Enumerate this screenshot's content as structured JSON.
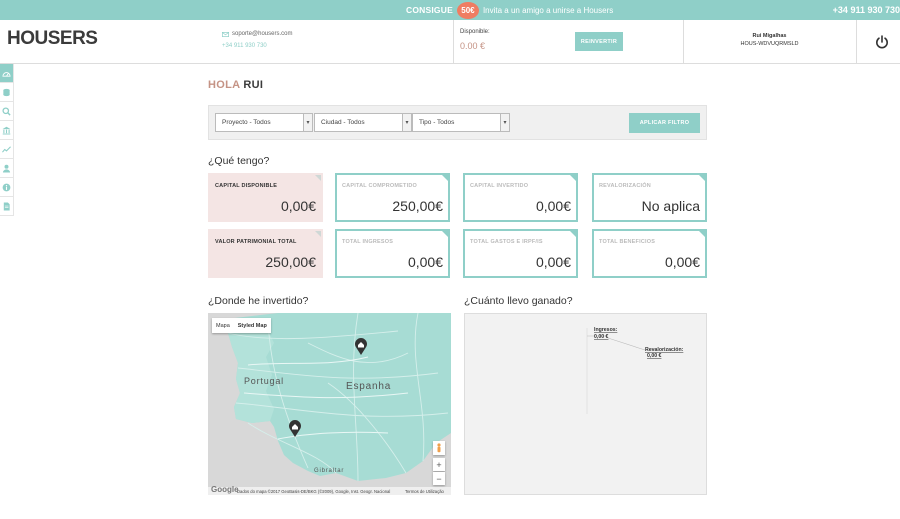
{
  "promo": {
    "strong": "CONSIGUE",
    "badge": "50€",
    "text": "Invita a un amigo a unirse a Housers",
    "phone": "+34 911 930 730"
  },
  "header": {
    "logo": "HOUSERS",
    "email": "soporte@housers.com",
    "phone": "+34 911 930 730",
    "available_label": "Disponible:",
    "available_value": "0.00 €",
    "reinvest_label": "REINVERTIR",
    "user_name": "Rui Migalhas",
    "user_code": "HOUS-WDVUQRMSLD"
  },
  "sidebar": {
    "icons": [
      "dashboard-icon",
      "database-icon",
      "search-icon",
      "bank-icon",
      "chart-icon",
      "user-icon",
      "info-icon",
      "document-icon"
    ]
  },
  "greeting": {
    "hello": "HOLA",
    "name": "RUI"
  },
  "filters": {
    "project": "Proyecto - Todos",
    "city": "Ciudad - Todos",
    "type": "Tipo - Todos",
    "apply_label": "APLICAR FILTRO"
  },
  "have": {
    "title": "¿Qué tengo?",
    "cards": [
      {
        "label": "CAPITAL DISPONIBLE",
        "value": "0,00€"
      },
      {
        "label": "CAPITAL COMPROMETIDO",
        "value": "250,00€"
      },
      {
        "label": "CAPITAL INVERTIDO",
        "value": "0,00€"
      },
      {
        "label": "REVALORIZACIÓN",
        "value": "No aplica"
      },
      {
        "label": "VALOR PATRIMONIAL TOTAL",
        "value": "250,00€"
      },
      {
        "label": "TOTAL INGRESOS",
        "value": "0,00€"
      },
      {
        "label": "TOTAL GASTOS E IRPF/IS",
        "value": "0,00€"
      },
      {
        "label": "TOTAL BENEFICIOS",
        "value": "0,00€"
      }
    ]
  },
  "where": {
    "title": "¿Donde he invertido?",
    "map_type_map": "Mapa",
    "map_type_styled": "Styled Map",
    "label_portugal": "Portugal",
    "label_spain": "Espanha",
    "label_gibraltar": "Gibraltar",
    "google": "Google",
    "attribution": "Dados do mapa ©2017 GeoBasis-DE/BKG (©2009), Google, Inst. Geogr. Nacional",
    "terms": "Termos de Utilização",
    "zoom_in": "+",
    "zoom_out": "−"
  },
  "earned": {
    "title": "¿Cuánto llevo ganado?"
  },
  "chart_data": {
    "type": "pie",
    "categories": [
      "Ingresos",
      "Revalorización"
    ],
    "values": [
      0.0,
      0.0
    ],
    "data_labels": [
      "Ingresos:",
      "0,00 €",
      "Revalorización:",
      "0,00 €"
    ]
  },
  "colors": {
    "accent": "#8fcfc8",
    "brand_text": "#c59385",
    "promo_badge": "#ef7d62",
    "card_pink": "#f4e5e4"
  }
}
